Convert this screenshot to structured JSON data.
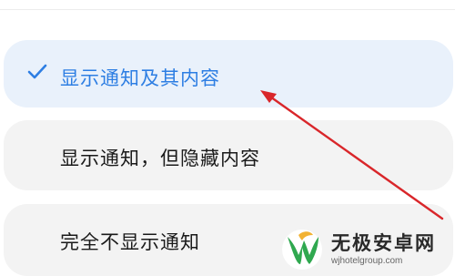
{
  "options": [
    {
      "label": "显示通知及其内容",
      "selected": true
    },
    {
      "label": "显示通知，但隐藏内容",
      "selected": false
    },
    {
      "label": "完全不显示通知",
      "selected": false
    }
  ],
  "watermark": {
    "title": "无极安卓网",
    "url": "wjhotelgroup.com"
  },
  "colors": {
    "accent": "#2d7ee3",
    "selected_bg": "#e9f1fb",
    "option_bg": "#f3f3f3",
    "annotation_arrow": "#d9262a"
  },
  "icons": {
    "selected_marker": "checkmark-icon",
    "annotation": "red-arrow-annotation",
    "watermark_logo": "leaf-w-logo"
  }
}
